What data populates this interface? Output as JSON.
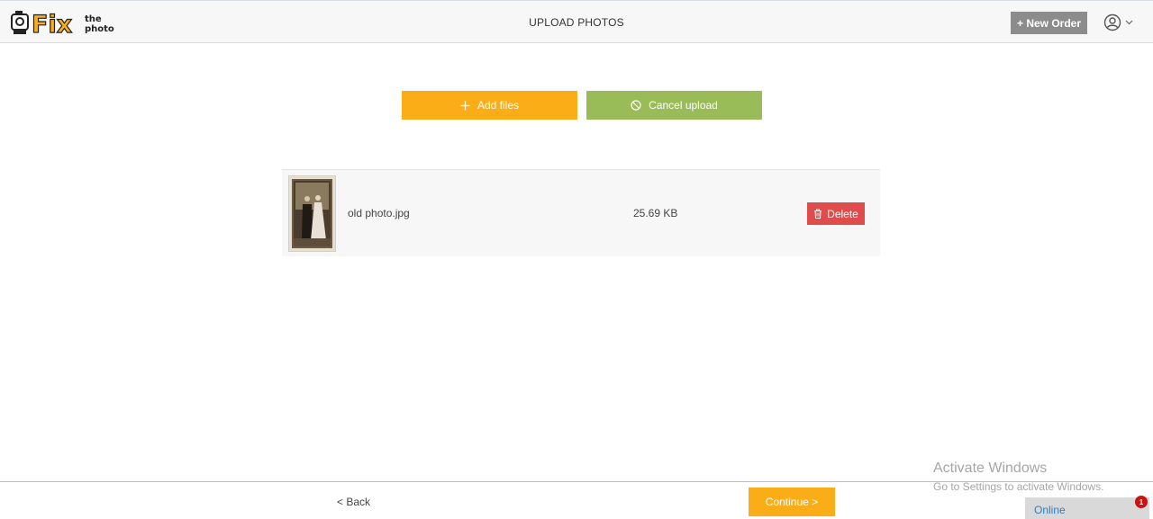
{
  "header": {
    "logo": {
      "fix": "Fix",
      "the": "the",
      "photo": "photo"
    },
    "title": "UPLOAD PHOTOS",
    "new_order_label": "+ New Order",
    "account_icon": "user-circle-icon",
    "chevron_icon": "chevron-down-icon"
  },
  "actions": {
    "add_files_label": "Add files",
    "add_files_icon": "plus-icon",
    "cancel_upload_label": "Cancel upload",
    "cancel_upload_icon": "ban-icon"
  },
  "files": [
    {
      "name": "old photo.jpg",
      "size": "25.69 KB",
      "delete_label": "Delete",
      "delete_icon": "trash-icon"
    }
  ],
  "footer": {
    "back_label": "< Back",
    "continue_label": "Continue >"
  },
  "overlay": {
    "activate_title": "Activate Windows",
    "activate_subtitle": "Go to Settings to activate Windows.",
    "online_label": "Online",
    "notification_count": "1"
  },
  "colors": {
    "accent_orange": "#fbad18",
    "accent_green": "#99bb58",
    "danger_red": "#e04b4b",
    "header_gray": "#8c8c8c"
  }
}
